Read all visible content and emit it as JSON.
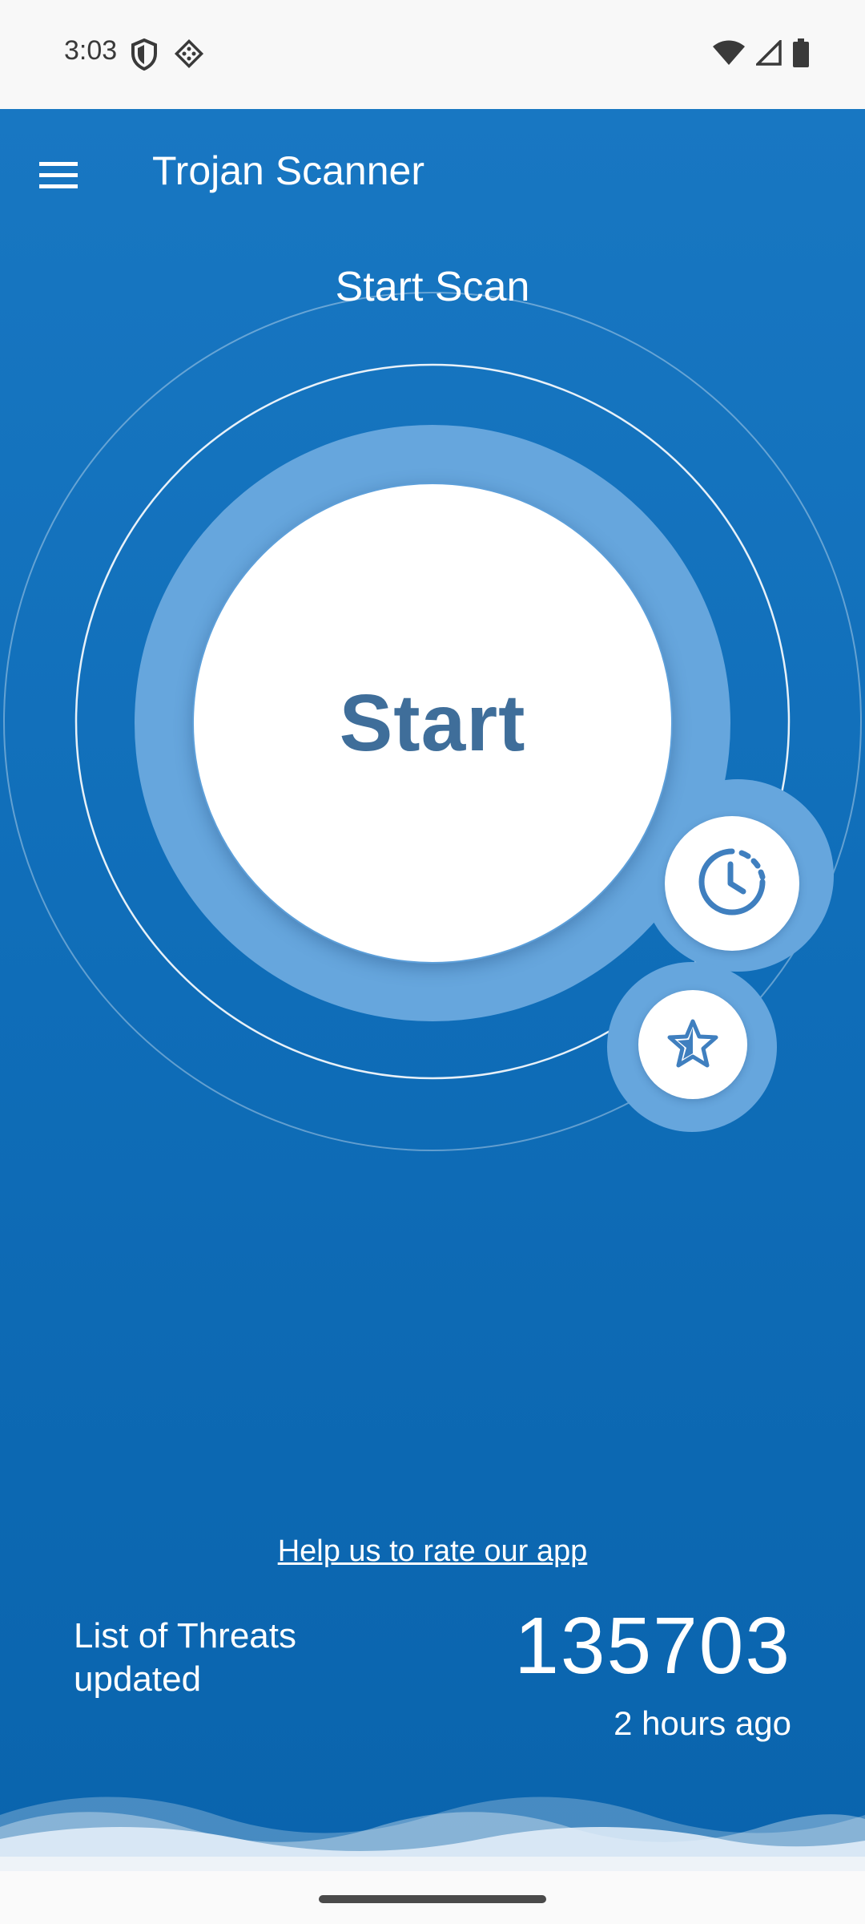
{
  "status_bar": {
    "time": "3:03",
    "left_icons": [
      "shield-icon",
      "vpn-diamond-icon"
    ],
    "right_icons": [
      "wifi-icon",
      "cell-signal-icon",
      "battery-icon"
    ]
  },
  "app_bar": {
    "title": "Trojan Scanner",
    "menu_icon": "hamburger-menu-icon"
  },
  "scan": {
    "heading": "Start Scan",
    "start_label": "Start",
    "schedule_icon": "clock-schedule-icon",
    "favorite_icon": "star-icon"
  },
  "footer": {
    "rate_link": "Help us to rate our app",
    "threats_label": "List of Threats updated",
    "threats_count": "135703",
    "threats_updated": "2 hours ago"
  },
  "colors": {
    "background_top": "#1877c2",
    "background_bottom": "#0a64ad",
    "ring_fill": "#66a6dd",
    "start_text": "#3f6e9a"
  }
}
